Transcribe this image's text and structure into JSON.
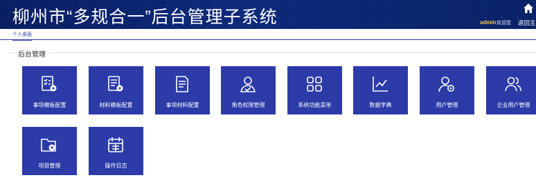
{
  "header": {
    "title": "柳州市“多规合一”后台管理子系统",
    "user_name": "admin",
    "welcome": "欢迎您",
    "back_home": "返回主页",
    "home_icon": "home-icon"
  },
  "tabs": [
    {
      "label": "个人桌面",
      "active": true
    }
  ],
  "section": {
    "title": "后台管理"
  },
  "tiles": [
    {
      "label": "事项模板配置",
      "icon": "checklist-gear-icon"
    },
    {
      "label": "材料模板配置",
      "icon": "document-gear-icon"
    },
    {
      "label": "事项材料配置",
      "icon": "document-icon"
    },
    {
      "label": "角色权限管理",
      "icon": "user-check-icon"
    },
    {
      "label": "系统功能菜单",
      "icon": "grid-menu-icon"
    },
    {
      "label": "数据字典",
      "icon": "line-chart-icon"
    },
    {
      "label": "用户管理",
      "icon": "user-gear-icon"
    },
    {
      "label": "企业用户管理",
      "icon": "users-group-icon"
    },
    {
      "label": "项目管理",
      "icon": "folder-gear-icon"
    },
    {
      "label": "操作日志",
      "icon": "calendar-log-icon"
    }
  ],
  "colors": {
    "header_bg": "#0d2a7a",
    "tile_bg": "#2c3ba8",
    "user_name": "#f2c94c",
    "tab_accent": "#3a4aa6"
  }
}
